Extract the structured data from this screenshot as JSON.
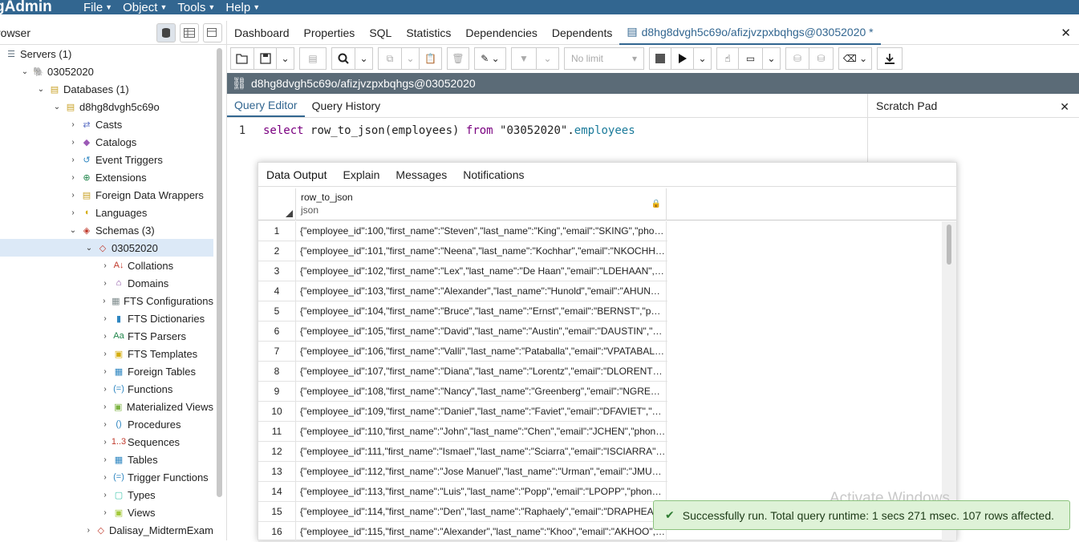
{
  "app": {
    "logo": "gAdmin"
  },
  "menu": [
    {
      "label": "File"
    },
    {
      "label": "Object"
    },
    {
      "label": "Tools"
    },
    {
      "label": "Help"
    }
  ],
  "browser": {
    "title": "rowser",
    "tree": [
      {
        "label": "Servers (1)",
        "level": 0,
        "expand": "",
        "icon": "servers-icon",
        "glyph": "☰",
        "color": "#5a6b7a"
      },
      {
        "label": "03052020",
        "level": 1,
        "expand": "⌄",
        "icon": "server-elephant-icon",
        "glyph": "🐘",
        "color": "#336791"
      },
      {
        "label": "Databases (1)",
        "level": 2,
        "expand": "⌄",
        "icon": "databases-icon",
        "glyph": "▤",
        "color": "#c9a227"
      },
      {
        "label": "d8hg8dvgh5c69o",
        "level": 3,
        "expand": "⌄",
        "icon": "database-icon",
        "glyph": "▤",
        "color": "#c9a227"
      },
      {
        "label": "Casts",
        "level": 4,
        "expand": "›",
        "icon": "casts-icon",
        "glyph": "⇄",
        "color": "#5b6fc4"
      },
      {
        "label": "Catalogs",
        "level": 4,
        "expand": "›",
        "icon": "catalogs-icon",
        "glyph": "◆",
        "color": "#9b59b6"
      },
      {
        "label": "Event Triggers",
        "level": 4,
        "expand": "›",
        "icon": "event-triggers-icon",
        "glyph": "↺",
        "color": "#2e86c1"
      },
      {
        "label": "Extensions",
        "level": 4,
        "expand": "›",
        "icon": "extensions-icon",
        "glyph": "⊕",
        "color": "#1e8449"
      },
      {
        "label": "Foreign Data Wrappers",
        "level": 4,
        "expand": "›",
        "icon": "foreign-data-wrappers-icon",
        "glyph": "▤",
        "color": "#c9a227"
      },
      {
        "label": "Languages",
        "level": 4,
        "expand": "›",
        "icon": "languages-icon",
        "glyph": "◖",
        "color": "#d4ac0d"
      },
      {
        "label": "Schemas (3)",
        "level": 4,
        "expand": "⌄",
        "icon": "schemas-icon",
        "glyph": "◈",
        "color": "#c0392b"
      },
      {
        "label": "03052020",
        "level": 5,
        "expand": "⌄",
        "icon": "schema-icon",
        "glyph": "◇",
        "color": "#c0392b",
        "selected": true
      },
      {
        "label": "Collations",
        "level": 6,
        "expand": "›",
        "icon": "collations-icon",
        "glyph": "A↓",
        "color": "#c0392b"
      },
      {
        "label": "Domains",
        "level": 6,
        "expand": "›",
        "icon": "domains-icon",
        "glyph": "⌂",
        "color": "#7d3c98"
      },
      {
        "label": "FTS Configurations",
        "level": 6,
        "expand": "›",
        "icon": "fts-configurations-icon",
        "glyph": "▦",
        "color": "#7f8c8d"
      },
      {
        "label": "FTS Dictionaries",
        "level": 6,
        "expand": "›",
        "icon": "fts-dictionaries-icon",
        "glyph": "▮",
        "color": "#2e86c1"
      },
      {
        "label": "FTS Parsers",
        "level": 6,
        "expand": "›",
        "icon": "fts-parsers-icon",
        "glyph": "Aa",
        "color": "#1e8449"
      },
      {
        "label": "FTS Templates",
        "level": 6,
        "expand": "›",
        "icon": "fts-templates-icon",
        "glyph": "▣",
        "color": "#d4ac0d"
      },
      {
        "label": "Foreign Tables",
        "level": 6,
        "expand": "›",
        "icon": "foreign-tables-icon",
        "glyph": "▦",
        "color": "#2e86c1"
      },
      {
        "label": "Functions",
        "level": 6,
        "expand": "›",
        "icon": "functions-icon",
        "glyph": "(=)",
        "color": "#2e86c1"
      },
      {
        "label": "Materialized Views",
        "level": 6,
        "expand": "›",
        "icon": "materialized-views-icon",
        "glyph": "▣",
        "color": "#7cb342"
      },
      {
        "label": "Procedures",
        "level": 6,
        "expand": "›",
        "icon": "procedures-icon",
        "glyph": "()",
        "color": "#2e86c1"
      },
      {
        "label": "Sequences",
        "level": 6,
        "expand": "›",
        "icon": "sequences-icon",
        "glyph": "1..3",
        "color": "#c0392b"
      },
      {
        "label": "Tables",
        "level": 6,
        "expand": "›",
        "icon": "tables-icon",
        "glyph": "▦",
        "color": "#2e86c1"
      },
      {
        "label": "Trigger Functions",
        "level": 6,
        "expand": "›",
        "icon": "trigger-functions-icon",
        "glyph": "(=)",
        "color": "#2e86c1"
      },
      {
        "label": "Types",
        "level": 6,
        "expand": "›",
        "icon": "types-icon",
        "glyph": "▢",
        "color": "#48c9b0"
      },
      {
        "label": "Views",
        "level": 6,
        "expand": "›",
        "icon": "views-icon",
        "glyph": "▣",
        "color": "#a3c93a"
      },
      {
        "label": "Dalisay_MidtermExam",
        "level": 5,
        "expand": "›",
        "icon": "schema-icon",
        "glyph": "◇",
        "color": "#c0392b"
      }
    ]
  },
  "tabs": [
    {
      "label": "Dashboard"
    },
    {
      "label": "Properties"
    },
    {
      "label": "SQL"
    },
    {
      "label": "Statistics"
    },
    {
      "label": "Dependencies"
    },
    {
      "label": "Dependents"
    },
    {
      "label": "d8hg8dvgh5c69o/afizjvzpxbqhgs@03052020 *",
      "active": true
    }
  ],
  "toolbar": {
    "limit": "No limit"
  },
  "connection": {
    "label": "d8hg8dvgh5c69o/afizjvzpxbqhgs@03052020"
  },
  "query_tabs": [
    {
      "label": "Query Editor",
      "active": true
    },
    {
      "label": "Query History"
    }
  ],
  "scratch": {
    "title": "Scratch Pad"
  },
  "editor": {
    "line": "1",
    "kw1": "select",
    "fn": "row_to_json",
    "arg": "(employees)",
    "kw2": "from",
    "schema": "\"03052020\"",
    "dot": ".",
    "table": "employees"
  },
  "output": {
    "tabs": [
      {
        "label": "Data Output",
        "active": true
      },
      {
        "label": "Explain"
      },
      {
        "label": "Messages"
      },
      {
        "label": "Notifications"
      }
    ],
    "column": {
      "name": "row_to_json",
      "type": "json"
    },
    "rows": [
      {
        "n": "1",
        "v": "{\"employee_id\":100,\"first_name\":\"Steven\",\"last_name\":\"King\",\"email\":\"SKING\",\"phone_n..."
      },
      {
        "n": "2",
        "v": "{\"employee_id\":101,\"first_name\":\"Neena\",\"last_name\":\"Kochhar\",\"email\":\"NKOCHHAR\",..."
      },
      {
        "n": "3",
        "v": "{\"employee_id\":102,\"first_name\":\"Lex\",\"last_name\":\"De Haan\",\"email\":\"LDEHAAN\",\"pho..."
      },
      {
        "n": "4",
        "v": "{\"employee_id\":103,\"first_name\":\"Alexander\",\"last_name\":\"Hunold\",\"email\":\"AHUNOLD..."
      },
      {
        "n": "5",
        "v": "{\"employee_id\":104,\"first_name\":\"Bruce\",\"last_name\":\"Ernst\",\"email\":\"BERNST\",\"phone..."
      },
      {
        "n": "6",
        "v": "{\"employee_id\":105,\"first_name\":\"David\",\"last_name\":\"Austin\",\"email\":\"DAUSTIN\",\"phon..."
      },
      {
        "n": "7",
        "v": "{\"employee_id\":106,\"first_name\":\"Valli\",\"last_name\":\"Pataballa\",\"email\":\"VPATABAL\",\"p..."
      },
      {
        "n": "8",
        "v": "{\"employee_id\":107,\"first_name\":\"Diana\",\"last_name\":\"Lorentz\",\"email\":\"DLORENTZ\",\"p..."
      },
      {
        "n": "9",
        "v": "{\"employee_id\":108,\"first_name\":\"Nancy\",\"last_name\":\"Greenberg\",\"email\":\"NGREENB..."
      },
      {
        "n": "10",
        "v": "{\"employee_id\":109,\"first_name\":\"Daniel\",\"last_name\":\"Faviet\",\"email\":\"DFAVIET\",\"phon..."
      },
      {
        "n": "11",
        "v": "{\"employee_id\":110,\"first_name\":\"John\",\"last_name\":\"Chen\",\"email\":\"JCHEN\",\"phone_n..."
      },
      {
        "n": "12",
        "v": "{\"employee_id\":111,\"first_name\":\"Ismael\",\"last_name\":\"Sciarra\",\"email\":\"ISCIARRA\",\"ph..."
      },
      {
        "n": "13",
        "v": "{\"employee_id\":112,\"first_name\":\"Jose Manuel\",\"last_name\":\"Urman\",\"email\":\"JMURM..."
      },
      {
        "n": "14",
        "v": "{\"employee_id\":113,\"first_name\":\"Luis\",\"last_name\":\"Popp\",\"email\":\"LPOPP\",\"phone_nu..."
      },
      {
        "n": "15",
        "v": "{\"employee_id\":114,\"first_name\":\"Den\",\"last_name\":\"Raphaely\",\"email\":\"DRAPHEAL\",\"p..."
      },
      {
        "n": "16",
        "v": "{\"employee_id\":115,\"first_name\":\"Alexander\",\"last_name\":\"Khoo\",\"email\":\"AKHOO\",\"pho..."
      }
    ]
  },
  "watermark": "Activate Windows",
  "toast": {
    "message": "Successfully run. Total query runtime: 1 secs 271 msec. 107 rows affected."
  }
}
